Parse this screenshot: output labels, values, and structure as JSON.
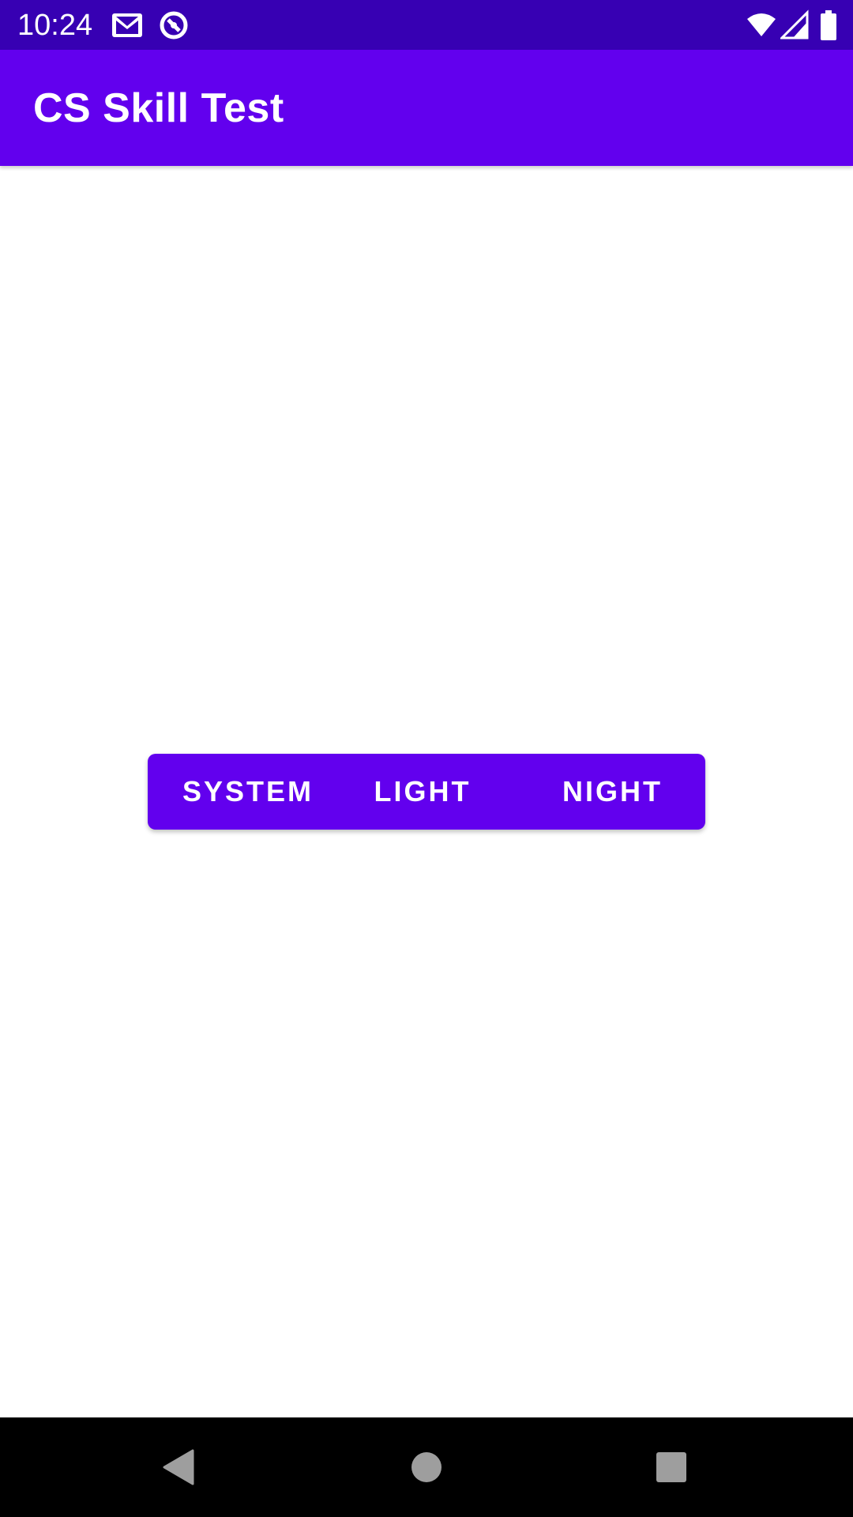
{
  "status_bar": {
    "time": "10:24",
    "left_icons": [
      "gmail-icon",
      "sync-icon"
    ],
    "right_icons": [
      "wifi-icon",
      "cell-signal-icon",
      "battery-icon"
    ],
    "background": "#3700B3"
  },
  "app_bar": {
    "title": "CS Skill Test",
    "background": "#6200EE"
  },
  "theme_toggle": {
    "options": [
      "SYSTEM",
      "LIGHT",
      "NIGHT"
    ],
    "accent": "#6200EE"
  },
  "nav_bar": {
    "buttons": [
      "back-icon",
      "home-icon",
      "recents-icon"
    ]
  }
}
